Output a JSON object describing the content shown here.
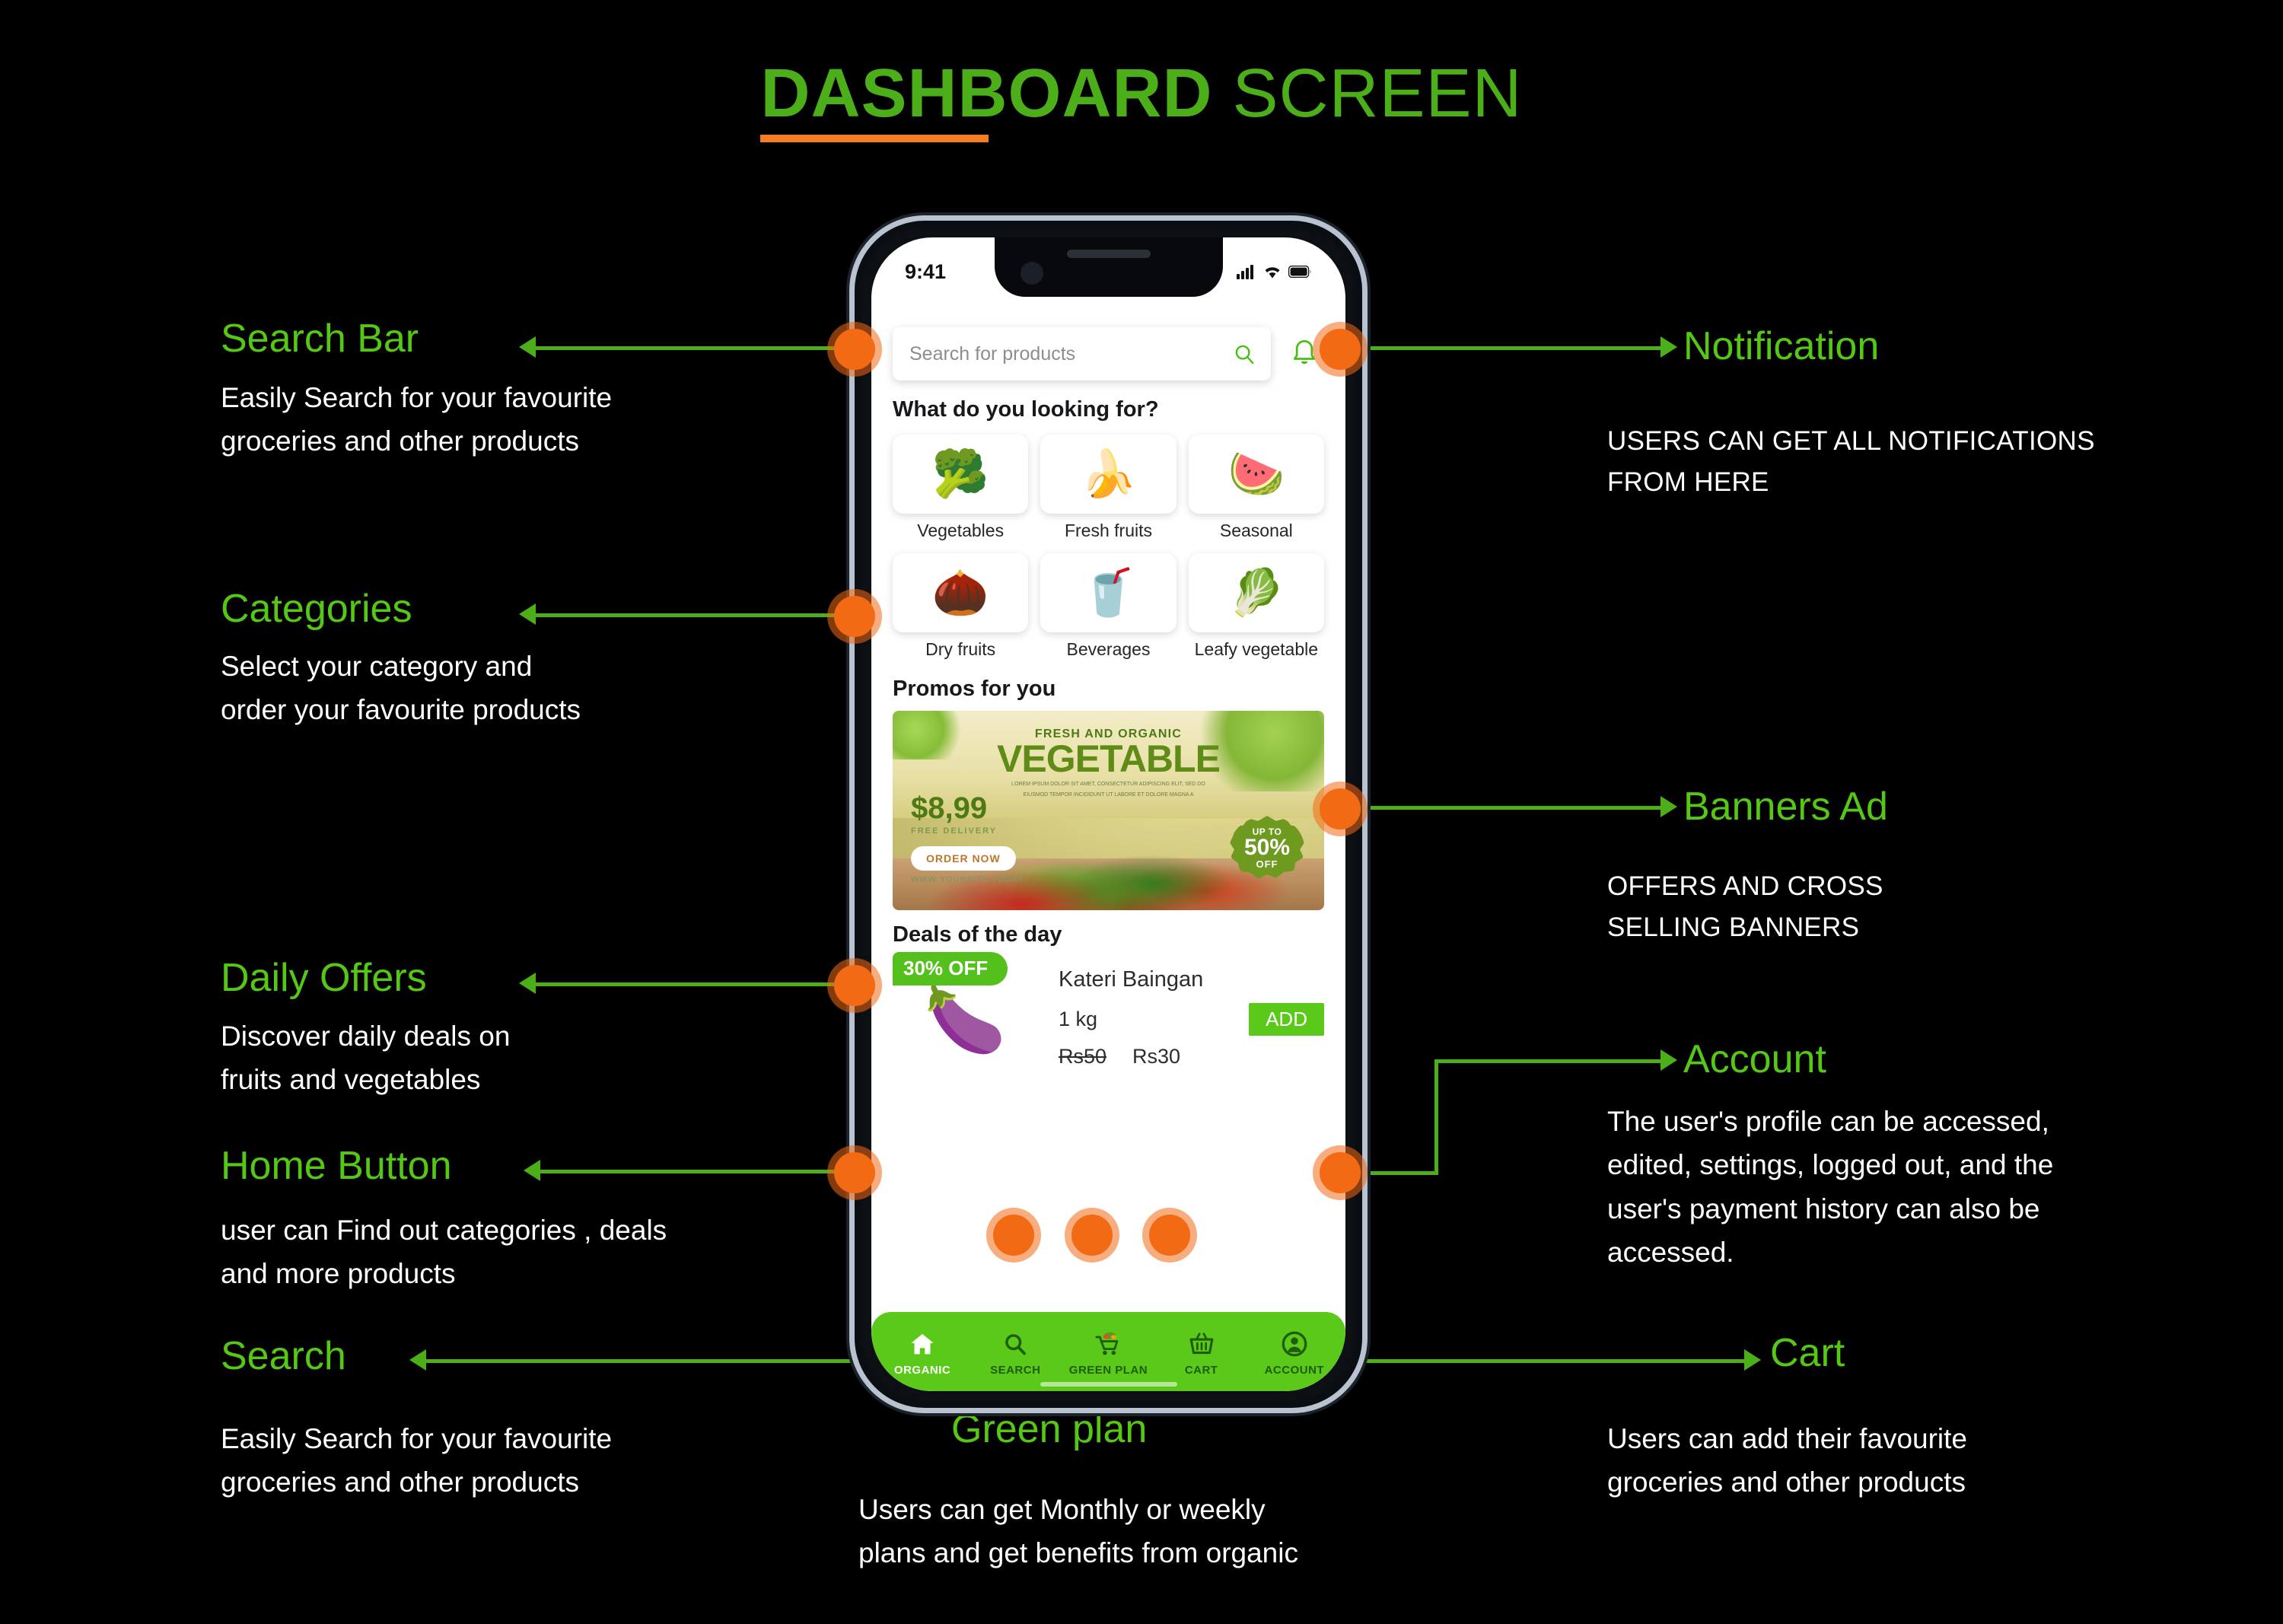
{
  "title": {
    "strong": "DASHBOARD",
    "light": " SCREEN",
    "underline_color": "#F57C20",
    "color": "#4CAF19"
  },
  "annotations": {
    "search_bar": {
      "label": "Search Bar",
      "desc_line1": "Easily Search  for your  favourite",
      "desc_line2": "groceries  and other  products"
    },
    "categories": {
      "label": "Categories",
      "desc_line1": "Select your category and",
      "desc_line2": "order your  favourite  products"
    },
    "daily_offers": {
      "label": "Daily Offers",
      "desc_line1": "Discover daily deals on",
      "desc_line2": "fruits and vegetables"
    },
    "home_button": {
      "label": "Home Button",
      "desc_line1": "user can Find out categories , deals",
      "desc_line2": "and more products"
    },
    "search": {
      "label": "Search",
      "desc_line1": "Easily Search  for your  favourite",
      "desc_line2": "groceries  and other  products"
    },
    "notification": {
      "label": "Notification",
      "desc_line1": "USERS CAN GET ALL NOTIFICATIONS",
      "desc_line2": "FROM HERE"
    },
    "banners_ad": {
      "label": "Banners Ad",
      "desc_line1": "OFFERS AND CROSS",
      "desc_line2": "SELLING BANNERS"
    },
    "account": {
      "label": "Account",
      "desc_line1": "The user's profile can be accessed,",
      "desc_line2": "edited, settings, logged out, and the",
      "desc_line3": "user's payment history can also be",
      "desc_line4": "accessed."
    },
    "cart": {
      "label": "Cart",
      "desc_line1": "Users can add their favourite",
      "desc_line2": "groceries and other products"
    },
    "green_plan": {
      "label": "Green plan",
      "desc_line1": "Users can get Monthly or weekly",
      "desc_line2": "plans and get benefits from organic"
    }
  },
  "phone": {
    "status": {
      "time": "9:41",
      "signal_icon": "cellular-bars-icon",
      "wifi_icon": "wifi-icon",
      "battery_icon": "battery-icon"
    },
    "search": {
      "placeholder": "Search for products",
      "value": "",
      "search_icon": "magnifier-icon",
      "bell_icon": "notification-bell-icon"
    },
    "sections": {
      "categories_title": "What do you looking for?",
      "promos_title": "Promos for you",
      "deals_title": "Deals of the day"
    },
    "categories": [
      {
        "label": "Vegetables",
        "icon": "broccoli-carrot-icon",
        "glyph": "🥦"
      },
      {
        "label": "Fresh fruits",
        "icon": "mixed-fruit-icon",
        "glyph": "🍌"
      },
      {
        "label": "Seasonal",
        "icon": "watermelon-icon",
        "glyph": "🍉"
      },
      {
        "label": "Dry fruits",
        "icon": "walnut-icon",
        "glyph": "🌰"
      },
      {
        "label": "Beverages",
        "icon": "soda-bottle-icon",
        "glyph": "🥤"
      },
      {
        "label": "Leafy vegetable",
        "icon": "lettuce-leaf-icon",
        "glyph": "🥬"
      }
    ],
    "banner": {
      "eyebrow": "FRESH AND ORGANIC",
      "headline": "VEGETABLE",
      "lorem1": "LOREM IPSUM DOLOR SIT AMET, CONSECTETUR ADIPISCING ELIT, SED DO",
      "lorem2": "EIUSMOD TEMPOR INCIDIDUNT UT LABORE ET DOLORE MAGNA A",
      "price": "$8,99",
      "delivery": "FREE DELIVERY",
      "cta": "ORDER NOW",
      "url": "WWW.YOURSITE.TODAY",
      "badge_top": "UP TO",
      "badge_value": "50%",
      "badge_bottom": "OFF"
    },
    "deal": {
      "discount_badge": "30% OFF",
      "name": "Kateri Baingan",
      "quantity": "1 kg",
      "add_label": "ADD",
      "price_old": "Rs50",
      "price_new": "Rs30",
      "product_icon": "eggplant-icon",
      "product_glyph": "🍆"
    },
    "tabs": [
      {
        "label": "ORGANIC",
        "icon": "home-icon",
        "active": true
      },
      {
        "label": "SEARCH",
        "icon": "magnifier-icon",
        "active": false
      },
      {
        "label": "GREEN PLAN",
        "icon": "shopping-cart-icon",
        "active": false
      },
      {
        "label": "CART",
        "icon": "basket-icon",
        "active": false
      },
      {
        "label": "ACCOUNT",
        "icon": "user-avatar-icon",
        "active": false
      }
    ]
  },
  "theme": {
    "accent_green": "#4CAF19",
    "label_green": "#55C816",
    "dot_orange": "#F26A14",
    "tabbar_green": "#5BC919",
    "background": "#000000"
  }
}
